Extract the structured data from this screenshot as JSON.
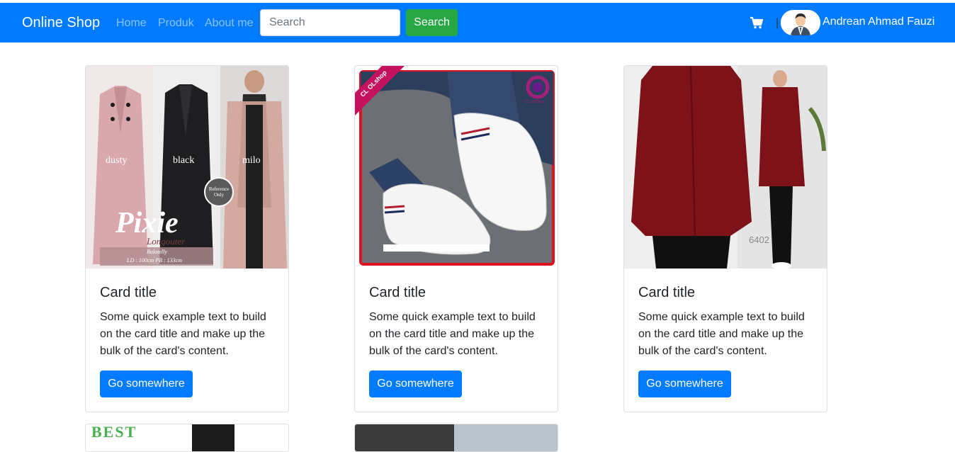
{
  "navbar": {
    "brand": "Online Shop",
    "links": [
      "Home",
      "Produk",
      "About me"
    ],
    "search_placeholder": "Search",
    "search_button": "Search",
    "cart_icon": "cart-icon",
    "divider": "|",
    "username": "Andrean Ahmad Fauzi",
    "colors": {
      "bg": "#007bff",
      "search_btn": "#28a745"
    }
  },
  "cards": [
    {
      "image_text": {
        "main": "Pixie",
        "sub": "Longouter",
        "labels": [
          "dusty",
          "black",
          "milo"
        ],
        "badge": "Reference Only",
        "note_brand": "Balotelly",
        "note_size": "LD : 100cm PB : 133cm"
      },
      "title": "Card title",
      "text": "Some quick example text to build on the card title and make up the bulk of the card's content.",
      "button": "Go somewhere"
    },
    {
      "image_text": {
        "ribbon": "CL OLshop",
        "logo": "CL olshop"
      },
      "title": "Card title",
      "text": "Some quick example text to build on the card title and make up the bulk of the card's content.",
      "button": "Go somewhere"
    },
    {
      "image_text": {
        "code": "6402"
      },
      "title": "Card title",
      "text": "Some quick example text to build on the card title and make up the bulk of the card's content.",
      "button": "Go somewhere"
    }
  ],
  "partial_cards": [
    {
      "visible_text": "BEST"
    },
    {
      "visible_text": ""
    }
  ]
}
